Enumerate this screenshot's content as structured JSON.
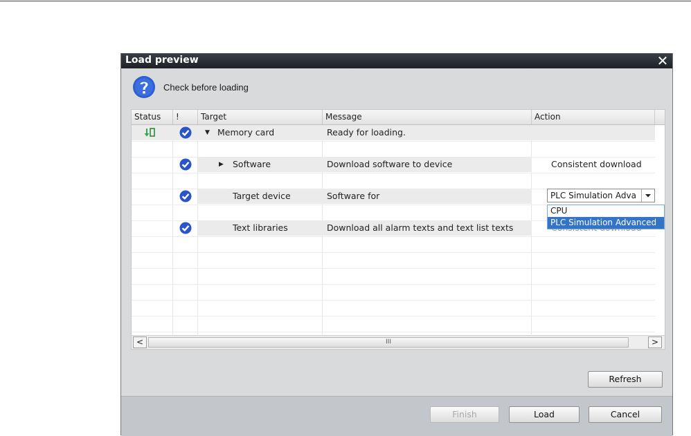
{
  "dialog": {
    "title": "Load preview",
    "header_text": "Check before loading"
  },
  "table": {
    "columns": [
      "Status",
      "!",
      "Target",
      "Message",
      "Action"
    ],
    "rows": [
      {
        "status_icon": "download-icon",
        "check": true,
        "expander": "expanded",
        "target": "Memory card",
        "message": "Ready for loading.",
        "action": ""
      },
      {
        "check": true,
        "expander": "collapsed",
        "target": "Software",
        "message": "Download software to device",
        "action": "Consistent download"
      },
      {
        "check": true,
        "expander": "",
        "target": "Target device",
        "message": "Software for",
        "action": "PLC Simulation Adva"
      },
      {
        "check": true,
        "expander": "",
        "target": "Text libraries",
        "message": "Download all alarm texts and text list texts",
        "action": "Consistent download"
      }
    ]
  },
  "dropdown": {
    "value": "PLC Simulation Adva",
    "options": [
      "CPU",
      "PLC Simulation Advanced"
    ],
    "selected_index": 1
  },
  "scrollbar": {
    "left": "<",
    "right": ">",
    "grip": "III"
  },
  "buttons": {
    "refresh": "Refresh",
    "finish": "Finish",
    "load": "Load",
    "cancel": "Cancel"
  },
  "colors": {
    "titlebar": "#2b2f36",
    "check": "#2a55c8",
    "selection": "#3374c6",
    "status_icon": "#2aa84a"
  }
}
